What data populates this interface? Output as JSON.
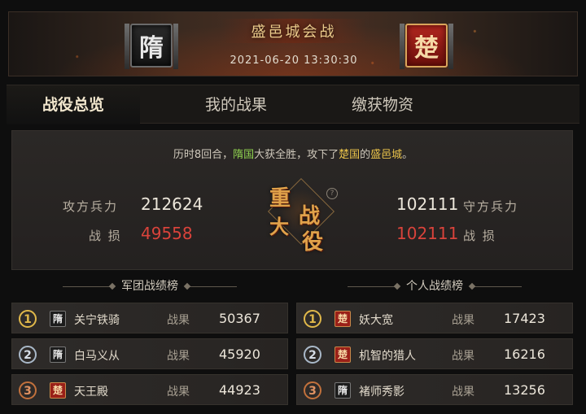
{
  "header": {
    "title": "盛邑城会战",
    "datetime": "2021-06-20  13:30:30",
    "attacker_emblem": "隋",
    "defender_emblem": "楚"
  },
  "tabs": [
    {
      "label": "战役总览",
      "active": true
    },
    {
      "label": "我的战果",
      "active": false
    },
    {
      "label": "缴获物资",
      "active": false
    }
  ],
  "summary": {
    "result_prefix": "历时8回合，",
    "winner": "隋国",
    "result_mid": "大获全胜，攻下了",
    "loser": "楚国",
    "result_of": "的",
    "city": "盛邑城",
    "result_end": "。",
    "attack_troops_label": "攻方兵力",
    "attack_troops": "212624",
    "attack_loss_label": "战 损",
    "attack_loss": "49558",
    "defend_troops_label": "守方兵力",
    "defend_troops": "102111",
    "defend_loss_label": "战 损",
    "defend_loss": "102111",
    "seal_chars": [
      "重",
      "大",
      "战",
      "役"
    ],
    "help_icon": "?"
  },
  "legion_board": {
    "title": "军团战绩榜",
    "rows": [
      {
        "rank": "1",
        "faction": "隋",
        "name": "关宁铁骑",
        "label": "战果",
        "value": "50367"
      },
      {
        "rank": "2",
        "faction": "隋",
        "name": "白马义从",
        "label": "战果",
        "value": "45920"
      },
      {
        "rank": "3",
        "faction": "楚",
        "name": "天王殿",
        "label": "战果",
        "value": "44923"
      }
    ]
  },
  "personal_board": {
    "title": "个人战绩榜",
    "rows": [
      {
        "rank": "1",
        "faction": "楚",
        "name": "妖大宽",
        "label": "战果",
        "value": "17423"
      },
      {
        "rank": "2",
        "faction": "楚",
        "name": "机智的猎人",
        "label": "战果",
        "value": "16216"
      },
      {
        "rank": "3",
        "faction": "隋",
        "name": "褚师秀影",
        "label": "战果",
        "value": "13256"
      }
    ]
  },
  "colors": {
    "winner_green": "#8fd14f",
    "city_yellow": "#e8c24a",
    "loss_red": "#d9433b",
    "sui_badge": "#1c1c1c",
    "chu_badge": "#9a2018"
  },
  "icons": {
    "attacker_emblem": "sui-banner-icon",
    "defender_emblem": "chu-banner-icon",
    "seal": "major-battle-seal-icon",
    "help": "help-icon",
    "rank_medal": "rank-medal-icon"
  }
}
